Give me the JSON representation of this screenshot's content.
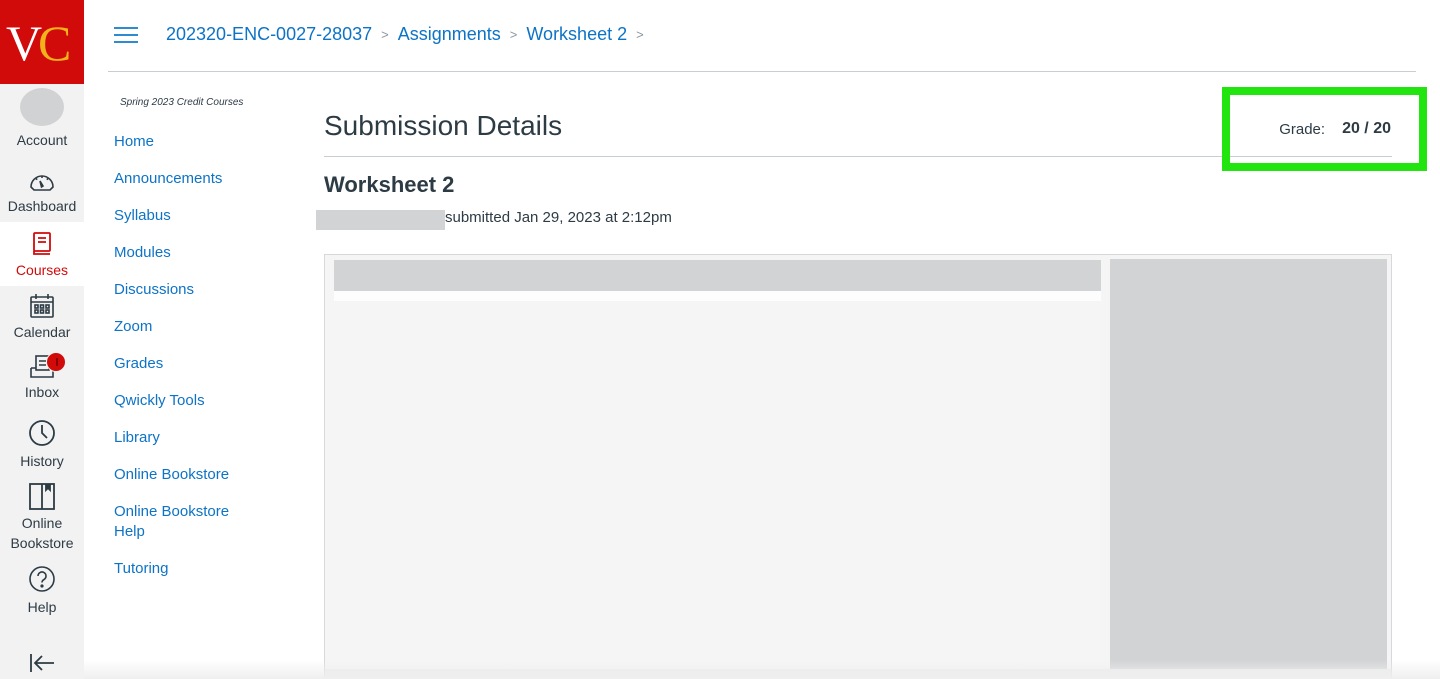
{
  "global_nav": {
    "logo": {
      "letters": [
        "V",
        "C"
      ],
      "bg_color": "#d10a0a",
      "accent_color": "#f2b21b"
    },
    "items": [
      {
        "label": "Account",
        "icon": "avatar-icon"
      },
      {
        "label": "Dashboard",
        "icon": "dashboard-icon"
      },
      {
        "label": "Courses",
        "icon": "courses-icon",
        "active": true
      },
      {
        "label": "Calendar",
        "icon": "calendar-icon"
      },
      {
        "label": "Inbox",
        "icon": "inbox-icon",
        "badge": true
      },
      {
        "label": "History",
        "icon": "history-icon"
      },
      {
        "label": "Online Bookstore",
        "icon": "bookstore-icon"
      },
      {
        "label": "Help",
        "icon": "help-icon"
      }
    ],
    "collapse_icon": "collapse-nav-icon"
  },
  "breadcrumb": {
    "items": [
      "202320-ENC-0027-28037",
      "Assignments",
      "Worksheet 2"
    ],
    "separator": ">"
  },
  "course_nav": {
    "term": "Spring 2023 Credit Courses",
    "items": [
      "Home",
      "Announcements",
      "Syllabus",
      "Modules",
      "Discussions",
      "Zoom",
      "Grades",
      "Qwickly Tools",
      "Library",
      "Online Bookstore",
      "Online Bookstore Help",
      "Tutoring"
    ]
  },
  "main": {
    "title": "Submission Details",
    "grade_label": "Grade:",
    "grade_value": "20 / 20",
    "assignment_title": "Worksheet 2",
    "submitted_text": "submitted Jan 29, 2023 at 2:12pm",
    "highlight_color": "#22e40f"
  }
}
